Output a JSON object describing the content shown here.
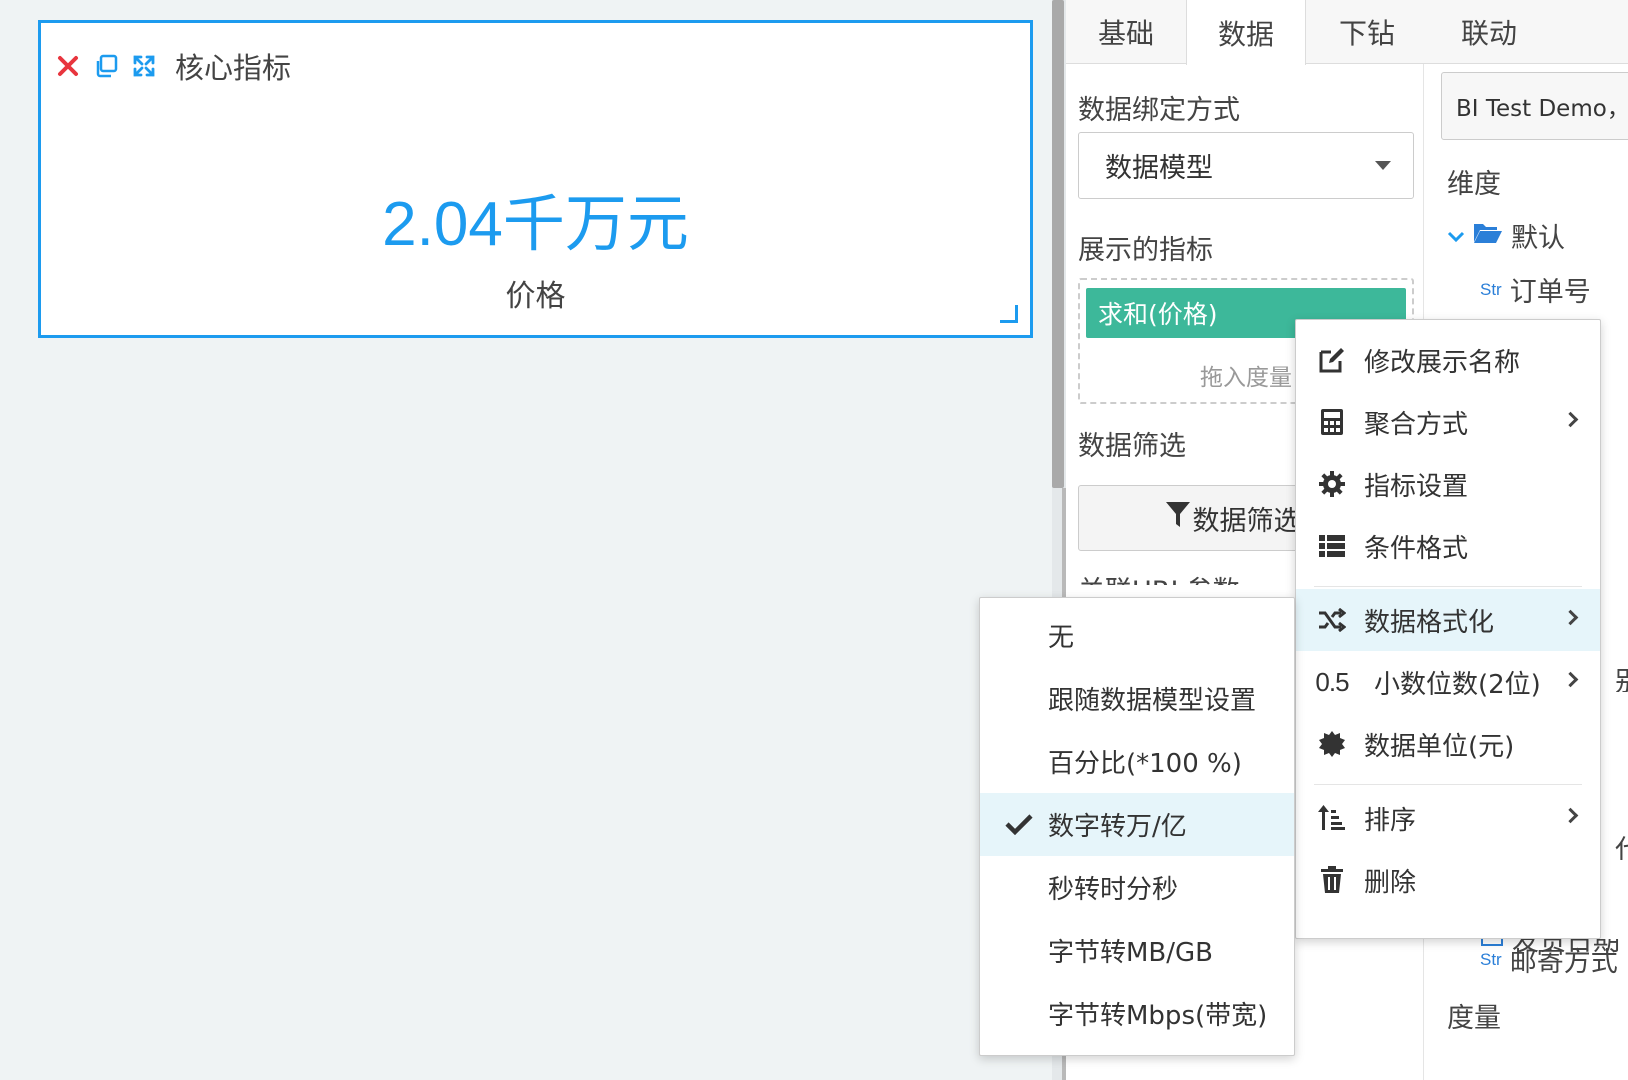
{
  "widget": {
    "title": "核心指标",
    "value": "2.04千万元",
    "label": "价格"
  },
  "tabs": [
    {
      "label": "基础",
      "active": false
    },
    {
      "label": "数据",
      "active": true
    },
    {
      "label": "下钻",
      "active": false
    },
    {
      "label": "联动",
      "active": false
    }
  ],
  "config": {
    "binding_label": "数据绑定方式",
    "binding_value": "数据模型",
    "metrics_label": "展示的指标",
    "metric_pill": "求和(价格)",
    "drop_hint": "拖入度量",
    "filter_label": "数据筛选",
    "filter_button": "数据筛选器",
    "url_params_label": "关联URL参数"
  },
  "fields": {
    "datasource": "BI Test Demo，JSON",
    "dimension_header": "维度",
    "folder": "默认",
    "str_tag": "Str",
    "order_no": "订单号",
    "shipping": "邮寄方式",
    "date_field": "发货日期",
    "measure_header": "度量",
    "clip_1": "别",
    "clip_2": "代"
  },
  "context_menu": {
    "items": [
      {
        "label": "修改展示名称",
        "icon": "edit-icon"
      },
      {
        "label": "聚合方式",
        "icon": "calculator-icon"
      },
      {
        "label": "指标设置",
        "icon": "gear-icon"
      },
      {
        "label": "条件格式",
        "icon": "list-icon"
      },
      {
        "label": "数据格式化",
        "icon": "shuffle-icon"
      },
      {
        "label": "小数位数(2位)",
        "icon": "decimal-icon",
        "icon_text": "0.5"
      },
      {
        "label": "数据单位(元)",
        "icon": "badge-icon"
      },
      {
        "label": "排序",
        "icon": "sort-icon"
      },
      {
        "label": "删除",
        "icon": "trash-icon"
      }
    ]
  },
  "format_submenu": {
    "items": [
      {
        "label": "无",
        "selected": false
      },
      {
        "label": "跟随数据模型设置",
        "selected": false
      },
      {
        "label": "百分比(*100 %)",
        "selected": false
      },
      {
        "label": "数字转万/亿",
        "selected": true
      },
      {
        "label": "秒转时分秒",
        "selected": false
      },
      {
        "label": "字节转MB/GB",
        "selected": false
      },
      {
        "label": "字节转Mbps(带宽)",
        "selected": false
      }
    ]
  },
  "colors": {
    "accent": "#1c9bef",
    "pill": "#3db89a",
    "highlight": "#e6f5fa",
    "close": "#e8353e"
  }
}
